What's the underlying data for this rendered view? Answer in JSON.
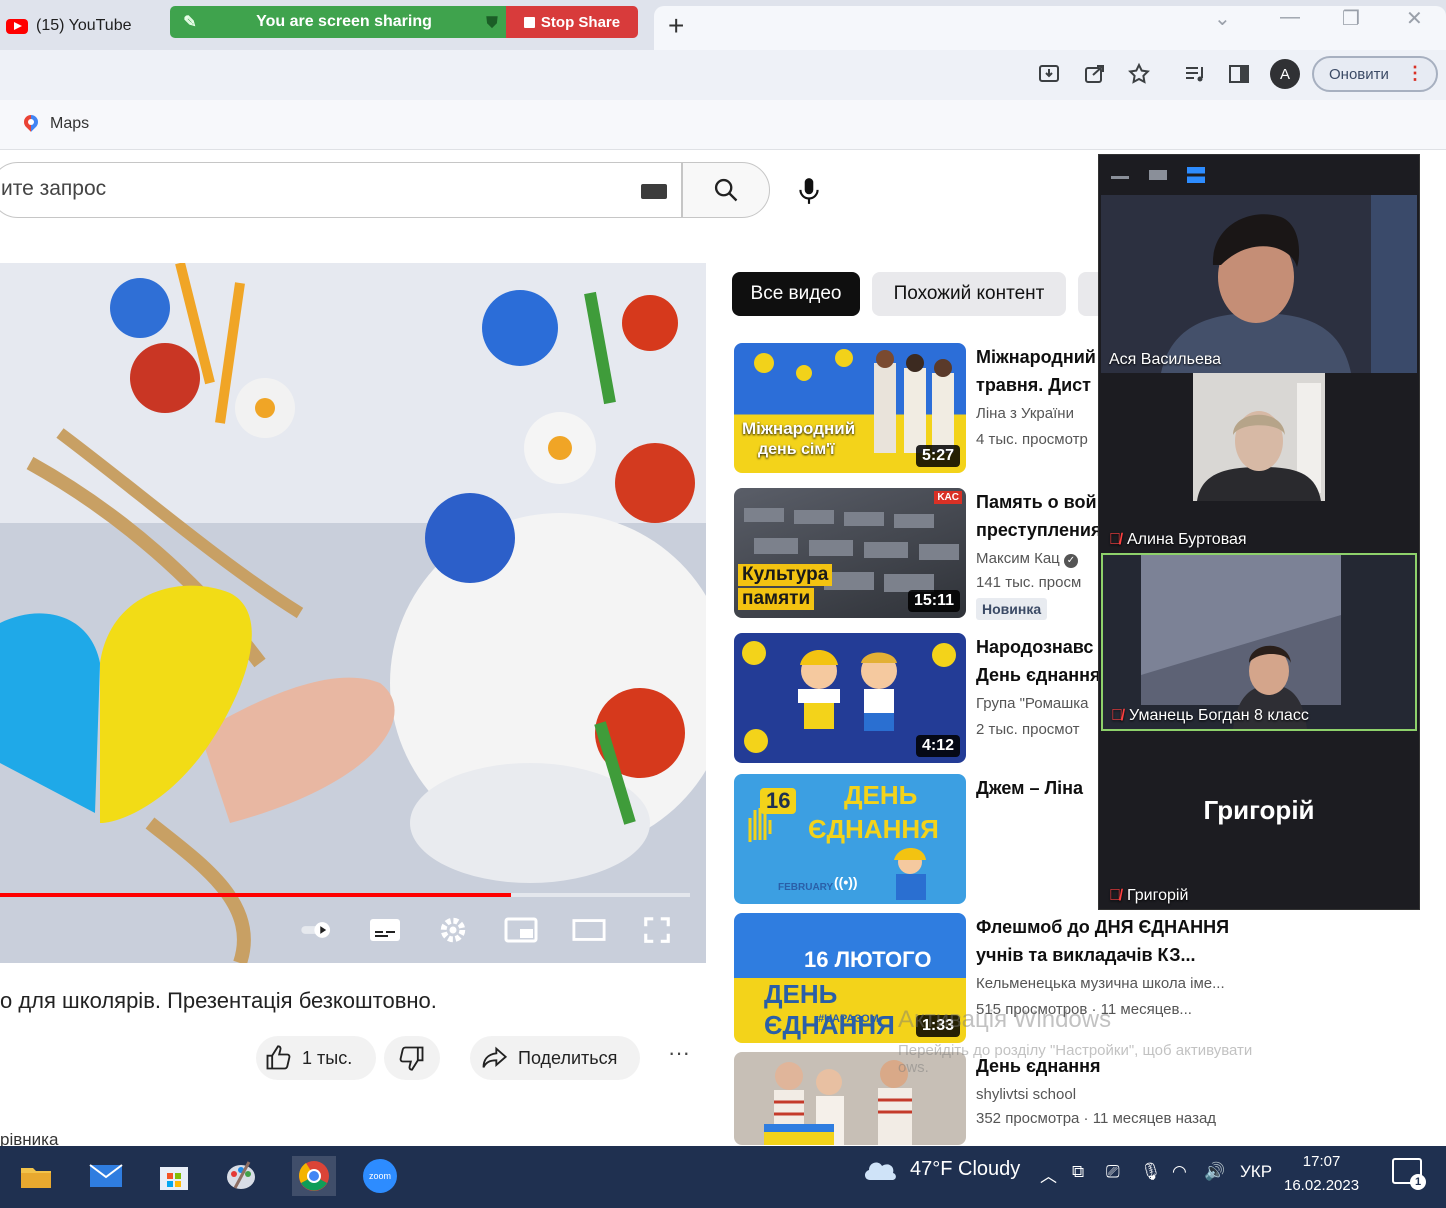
{
  "browser": {
    "tab_title": "(15) YouTube",
    "screen_share_banner": "You are screen sharing",
    "stop_share_label": "Stop Share",
    "new_tab_symbol": "+",
    "update_button": "Оновити",
    "avatar_letter": "A",
    "bookmark_maps": "Maps"
  },
  "youtube": {
    "search_placeholder": "ите запрос",
    "chips": [
      "Все видео",
      "Похожий контент"
    ],
    "video_title": "о для школярів. Презентація безкоштовно.",
    "like_count": "1 тыс.",
    "share_label": "Поделиться",
    "more_symbol": "···",
    "footer_text": "рівника",
    "player_progress": 0.74,
    "recommendations": [
      {
        "title_line1": "Міжнародний",
        "title_line2": "травня. Дист",
        "channel": "Ліна з України",
        "meta": "4 тыс. просмотр",
        "duration": "5:27",
        "thumb_text_1": "Міжнародний",
        "thumb_text_2": "день сім'ї"
      },
      {
        "title_line1": "Память о вой",
        "title_line2": "преступления",
        "channel": "Максим Кац",
        "meta": "141 тыс. просм",
        "duration": "15:11",
        "thumb_text_1": "Культура",
        "thumb_text_2": "памяти",
        "thumb_corner": "KAC",
        "badge": "Новинка"
      },
      {
        "title_line1": "Народознавс",
        "title_line2": "День єднання",
        "channel": "Група \"Ромашка",
        "meta": "2 тыс. просмот",
        "duration": "4:12"
      },
      {
        "title_line1": "Джем – Ліна",
        "thumb_text_1": "16",
        "thumb_text_2": "ДЕНЬ",
        "thumb_text_3": "ЄДНАННЯ",
        "thumb_text_4": "FEBRUARY"
      },
      {
        "title_line1": "Флешмоб до ДНЯ ЄДНАННЯ",
        "title_line2": "учнів та викладачів КЗ...",
        "channel": "Кельменецька музична школа іме...",
        "meta": "515 просмотров · 11 месяцев...",
        "duration": "1:33",
        "thumb_text_1": "16 ЛЮТОГО",
        "thumb_text_2": "ДЕНЬ ЄДНАННЯ",
        "thumb_text_3": "#UAРАЗОМ"
      },
      {
        "title_line1": "День єднання",
        "channel": "shylivtsi school",
        "meta": "352 просмотра · 11 месяцев назад"
      }
    ]
  },
  "zoom": {
    "participants": [
      "Ася Васильева",
      "Алина Буртовая",
      "Уманець Богдан 8 класс",
      "Григорій"
    ],
    "big_name": "Григорій"
  },
  "watermark": {
    "title": "Активація Windows",
    "text": "Перейдіть до розділу \"Настройки\", щоб активувати",
    "text2": "ows."
  },
  "taskbar": {
    "weather": "47°F  Cloudy",
    "language": "УКР",
    "time": "17:07",
    "date": "16.02.2023",
    "notification_count": "1",
    "zoom_label": "zoom"
  },
  "colors": {
    "share_green": "#3fa34d",
    "stop_red": "#d83b3b",
    "youtube_red": "#ff0000",
    "taskbar": "#1f3050",
    "zoom_bg": "#1c1c21",
    "active_speaker": "#8ed16b"
  }
}
